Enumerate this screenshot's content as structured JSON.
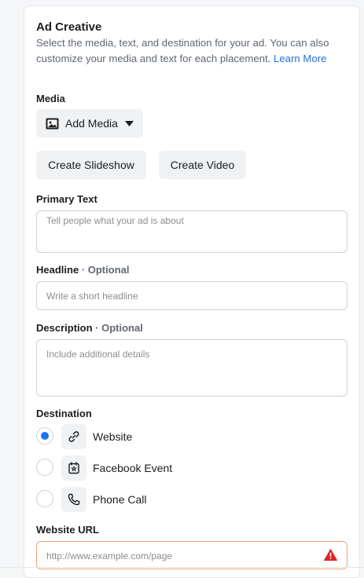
{
  "ad_creative": {
    "title": "Ad Creative",
    "subtitle": "Select the media, text, and destination for your ad. You can also customize your media and text for each placement.",
    "learn_more": "Learn More"
  },
  "media": {
    "label": "Media",
    "add_media": "Add Media",
    "create_slideshow": "Create Slideshow",
    "create_video": "Create Video"
  },
  "primary_text": {
    "label": "Primary Text",
    "placeholder": "Tell people what your ad is about"
  },
  "headline": {
    "label": "Headline",
    "optional": "· Optional",
    "placeholder": "Write a short headline"
  },
  "description": {
    "label": "Description",
    "optional": "· Optional",
    "placeholder": "Include additional details"
  },
  "destination": {
    "label": "Destination",
    "options": [
      {
        "label": "Website",
        "icon": "link-icon",
        "selected": true
      },
      {
        "label": "Facebook Event",
        "icon": "event-icon",
        "selected": false
      },
      {
        "label": "Phone Call",
        "icon": "phone-icon",
        "selected": false
      }
    ]
  },
  "website_url": {
    "label": "Website URL",
    "placeholder": "http://www.example.com/page",
    "status_icon": "warning-icon"
  },
  "colors": {
    "accent": "#1877f2",
    "link": "#216fdb",
    "error_border": "#f0a478",
    "error_icon": "#e0242a"
  }
}
